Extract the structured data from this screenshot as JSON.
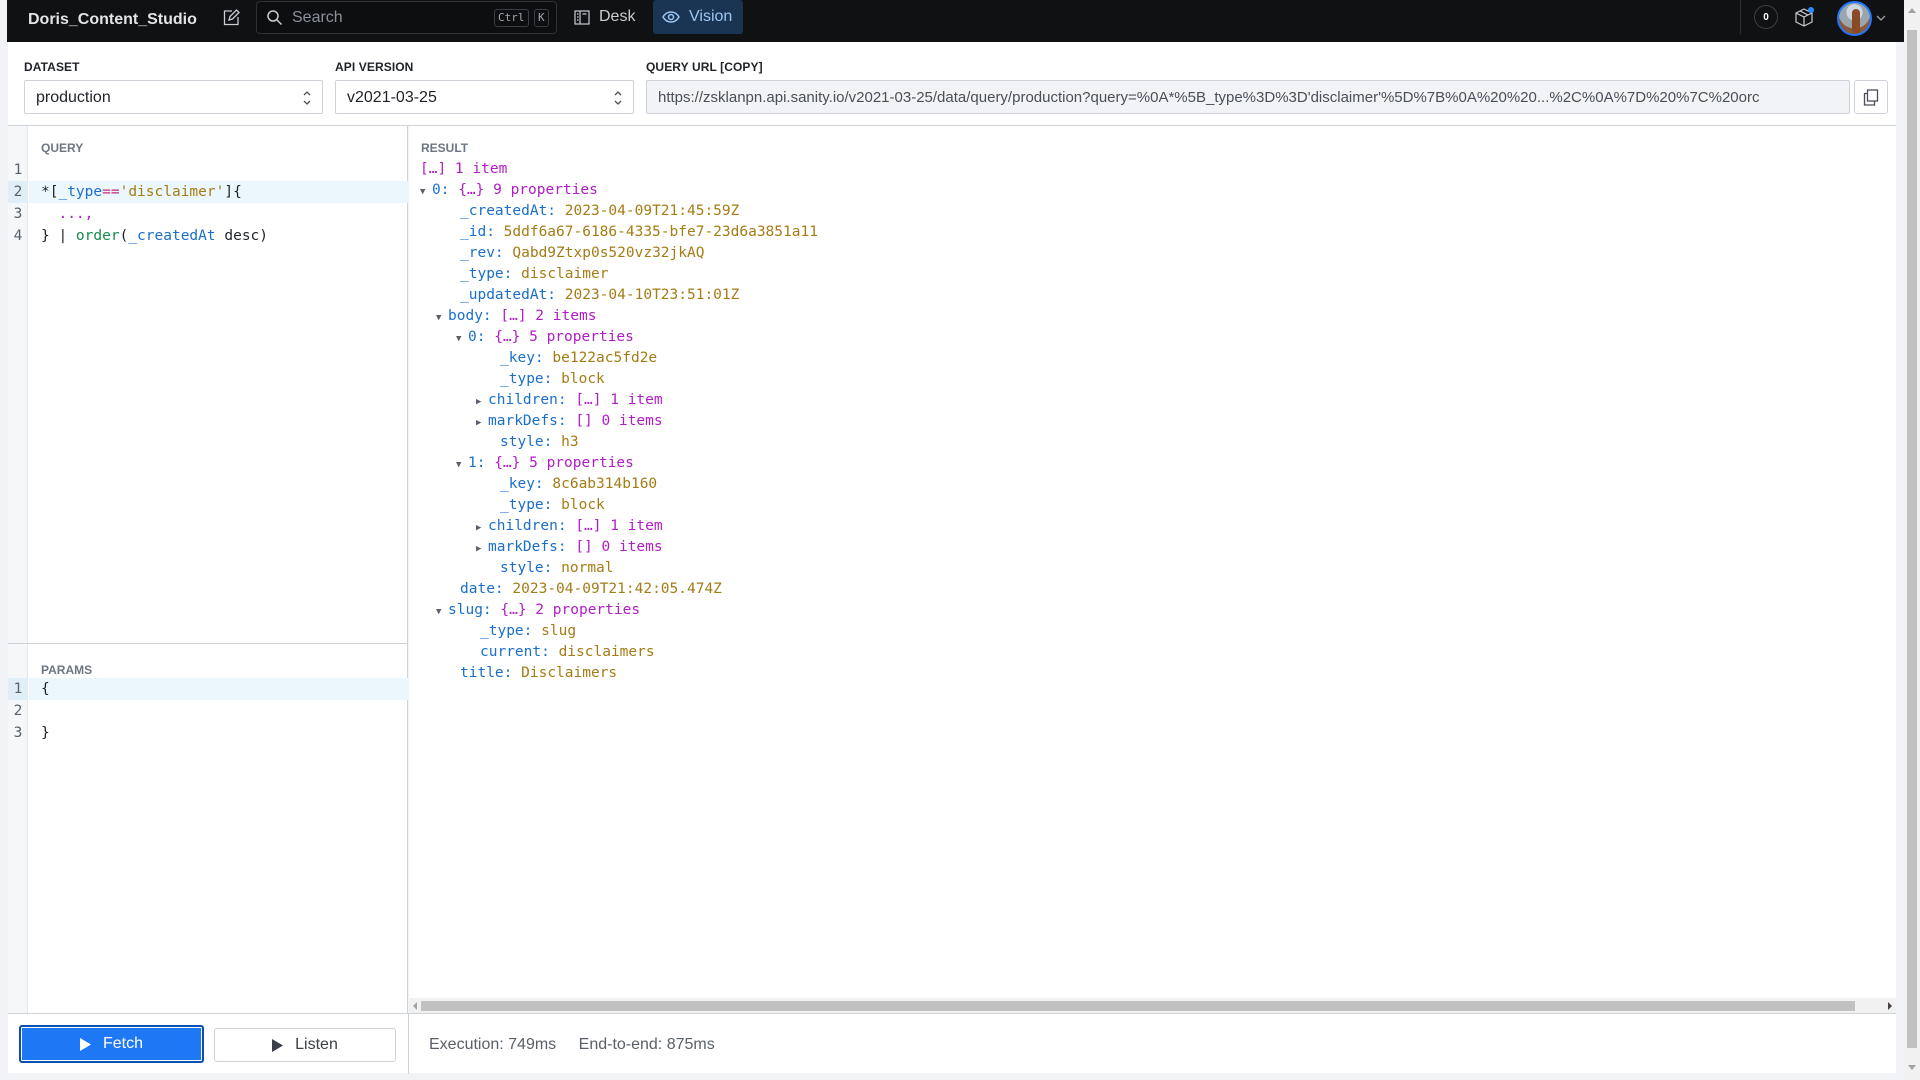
{
  "app": {
    "title": "Doris_Content_Studio",
    "search_placeholder": "Search",
    "search_shortcut": [
      "Ctrl",
      "K"
    ],
    "nav_tabs": [
      {
        "label": "Desk",
        "icon": "desk-icon",
        "active": false
      },
      {
        "label": "Vision",
        "icon": "eye-icon",
        "active": true
      }
    ],
    "notification_count": "0",
    "accent_color": "#1e78f5"
  },
  "header": {
    "dataset": {
      "label": "DATASET",
      "value": "production"
    },
    "api_version": {
      "label": "API VERSION",
      "value": "v2021-03-25"
    },
    "query_url": {
      "label": "QUERY URL [COPY]",
      "value": "https://zsklanpn.api.sanity.io/v2021-03-25/data/query/production?query=%0A*%5B_type%3D%3D'disclaimer'%5D%7B%0A%20%20...%2C%0A%7D%20%7C%20orc"
    }
  },
  "query": {
    "label": "QUERY",
    "line_numbers": [
      "1",
      "2",
      "3",
      "4"
    ],
    "lines": {
      "l2_star": "*[",
      "l2_field": "_type",
      "l2_op": "==",
      "l2_str": "'disclaimer'",
      "l2_end": "]{",
      "l3": "  ...,",
      "l4_start": "} | ",
      "l4_fn": "order",
      "l4_paren": "(",
      "l4_arg": "_createdAt",
      "l4_end": " desc)"
    }
  },
  "params": {
    "label": "PARAMS",
    "line_numbers": [
      "1",
      "2",
      "3"
    ],
    "lines": [
      "{",
      "",
      "}"
    ]
  },
  "result": {
    "label": "RESULT",
    "rows": [
      {
        "indent": 0,
        "toggle": "",
        "key": "",
        "meta": "[…] 1 item",
        "value": ""
      },
      {
        "indent": 0,
        "toggle": "▼",
        "key": "0:",
        "meta": "{…} 9 properties",
        "value": ""
      },
      {
        "indent": 2,
        "toggle": "",
        "key": "_createdAt:",
        "meta": "",
        "value": "2023-04-09T21:45:59Z"
      },
      {
        "indent": 2,
        "toggle": "",
        "key": "_id:",
        "meta": "",
        "value": "5ddf6a67-6186-4335-bfe7-23d6a3851a11"
      },
      {
        "indent": 2,
        "toggle": "",
        "key": "_rev:",
        "meta": "",
        "value": "Qabd9Ztxp0s520vz32jkAQ"
      },
      {
        "indent": 2,
        "toggle": "",
        "key": "_type:",
        "meta": "",
        "value": "disclaimer"
      },
      {
        "indent": 2,
        "toggle": "",
        "key": "_updatedAt:",
        "meta": "",
        "value": "2023-04-10T23:51:01Z"
      },
      {
        "indent": 1,
        "toggle": "▼",
        "key": "body:",
        "meta": "[…] 2 items",
        "value": ""
      },
      {
        "indent": 2,
        "toggle": "▼",
        "key": "0:",
        "meta": "{…} 5 properties",
        "value": ""
      },
      {
        "indent": 4,
        "toggle": "",
        "key": "_key:",
        "meta": "",
        "value": "be122ac5fd2e"
      },
      {
        "indent": 4,
        "toggle": "",
        "key": "_type:",
        "meta": "",
        "value": "block"
      },
      {
        "indent": 3,
        "toggle": "▶",
        "key": "children:",
        "meta": "[…] 1 item",
        "value": ""
      },
      {
        "indent": 3,
        "toggle": "▶",
        "key": "markDefs:",
        "meta": "[] 0 items",
        "value": ""
      },
      {
        "indent": 4,
        "toggle": "",
        "key": "style:",
        "meta": "",
        "value": "h3"
      },
      {
        "indent": 2,
        "toggle": "▼",
        "key": "1:",
        "meta": "{…} 5 properties",
        "value": ""
      },
      {
        "indent": 4,
        "toggle": "",
        "key": "_key:",
        "meta": "",
        "value": "8c6ab314b160"
      },
      {
        "indent": 4,
        "toggle": "",
        "key": "_type:",
        "meta": "",
        "value": "block"
      },
      {
        "indent": 3,
        "toggle": "▶",
        "key": "children:",
        "meta": "[…] 1 item",
        "value": ""
      },
      {
        "indent": 3,
        "toggle": "▶",
        "key": "markDefs:",
        "meta": "[] 0 items",
        "value": ""
      },
      {
        "indent": 4,
        "toggle": "",
        "key": "style:",
        "meta": "",
        "value": "normal"
      },
      {
        "indent": 2,
        "toggle": "",
        "key": "date:",
        "meta": "",
        "value": "2023-04-09T21:42:05.474Z"
      },
      {
        "indent": 1,
        "toggle": "▼",
        "key": "slug:",
        "meta": "{…} 2 properties",
        "value": ""
      },
      {
        "indent": 3,
        "toggle": "",
        "key": "_type:",
        "meta": "",
        "value": "slug"
      },
      {
        "indent": 3,
        "toggle": "",
        "key": "current:",
        "meta": "",
        "value": "disclaimers"
      },
      {
        "indent": 2,
        "toggle": "",
        "key": "title:",
        "meta": "",
        "value": "Disclaimers"
      }
    ]
  },
  "footer": {
    "fetch_label": "Fetch",
    "listen_label": "Listen",
    "execution": "Execution: 749ms",
    "end_to_end": "End-to-end: 875ms"
  }
}
